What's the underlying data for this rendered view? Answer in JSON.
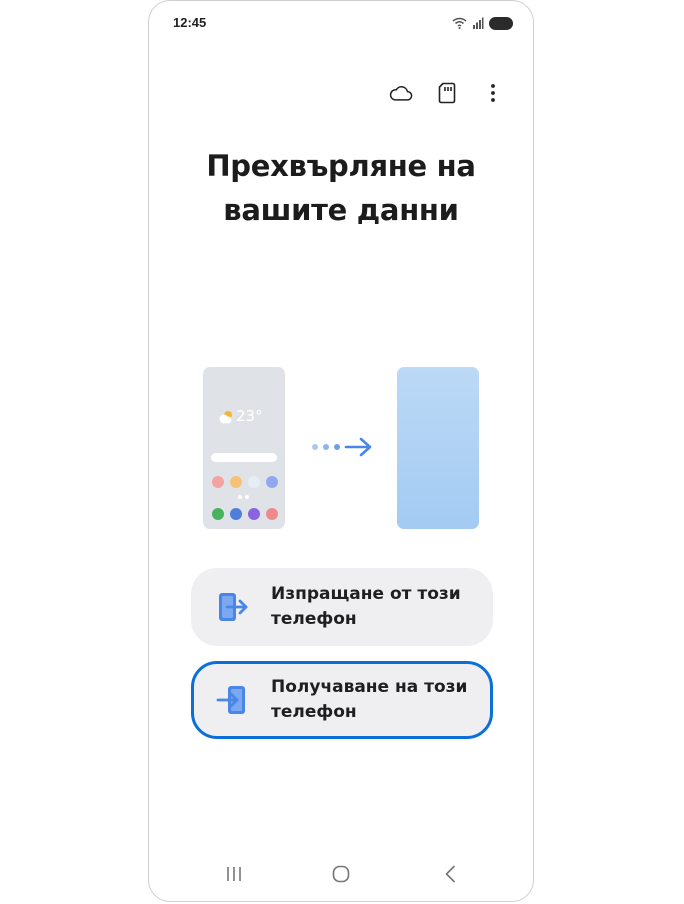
{
  "status_bar": {
    "time": "12:45"
  },
  "toolbar": {
    "icons": [
      "cloud-icon",
      "sd-card-icon",
      "more-options-icon"
    ]
  },
  "title": {
    "line1": "Прехвърляне на",
    "line2": "вашите данни"
  },
  "illustration": {
    "temperature": "23°",
    "app_dot_colors_row1": [
      "#f4a3a3",
      "#f6c27a",
      "#e5edf5",
      "#8fa8f0"
    ],
    "app_dot_colors_row2": [
      "#49b25c",
      "#4f7ddc",
      "#8a63e0",
      "#f08a8a"
    ],
    "accent": "#4a86e8"
  },
  "options": {
    "send": {
      "line1": "Изпращане от този",
      "line2": "телефон"
    },
    "receive": {
      "line1": "Получаване на този",
      "line2": "телефон"
    }
  },
  "colors": {
    "selected_border": "#0b6fd8",
    "option_bg": "#efeff1",
    "icon_blue": "#4a86e8"
  },
  "nav_bar": {
    "buttons": [
      "recent-apps-icon",
      "home-icon",
      "back-icon"
    ]
  }
}
